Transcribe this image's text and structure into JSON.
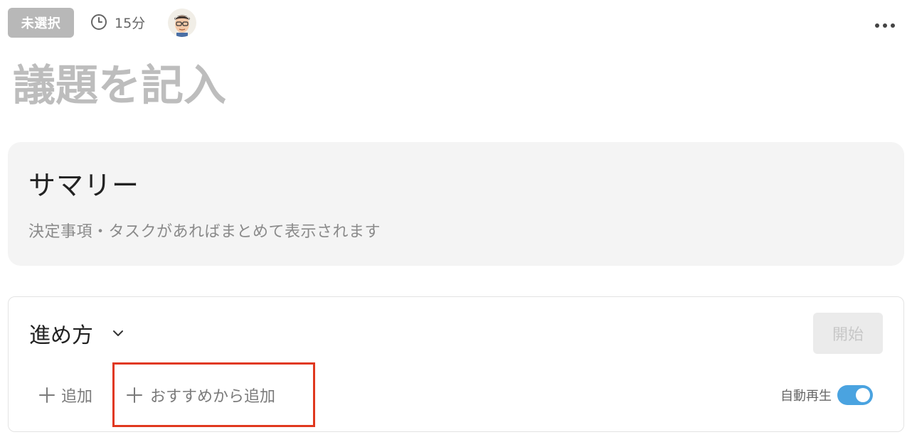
{
  "header": {
    "status_label": "未選択",
    "duration": "15分"
  },
  "agenda": {
    "title_placeholder": "議題を記入"
  },
  "summary": {
    "title": "サマリー",
    "description": "決定事項・タスクがあればまとめて表示されます"
  },
  "steps": {
    "title": "進め方",
    "start_label": "開始",
    "add_label": "追加",
    "recommend_label": "おすすめから追加",
    "autoplay_label": "自動再生",
    "autoplay_on": true
  },
  "colors": {
    "badge_bg": "#b8b8b8",
    "toggle_on": "#4aa3e0",
    "highlight_border": "#e0381e",
    "card_bg": "#f4f4f4"
  },
  "icons": [
    "clock-icon",
    "avatar",
    "more-icon",
    "chevron-down-icon",
    "plus-icon"
  ]
}
